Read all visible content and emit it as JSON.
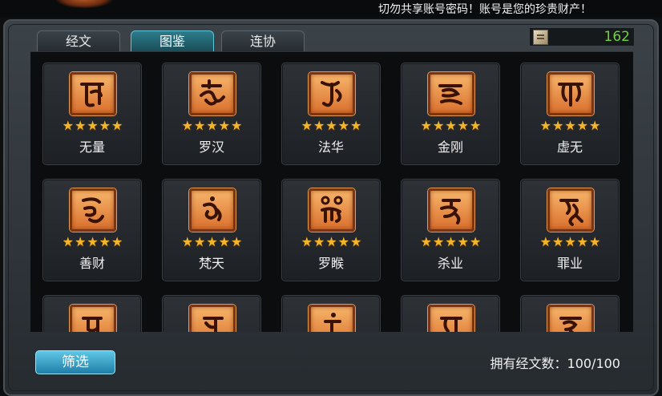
{
  "top_banner": {
    "message": "切勿共享账号密码！账号是您的珍贵财产！"
  },
  "tabs": [
    {
      "label": "经文",
      "active": false
    },
    {
      "label": "图鉴",
      "active": true
    },
    {
      "label": "连协",
      "active": false
    }
  ],
  "currency": {
    "icon": "scroll-icon",
    "value": "162",
    "color": "#6cd33a"
  },
  "star_glyphs": "★★★★★",
  "cards": [
    {
      "name": "无量",
      "stars": 5,
      "icon": "rune-wuliang-icon"
    },
    {
      "name": "罗汉",
      "stars": 5,
      "icon": "rune-luohan-icon"
    },
    {
      "name": "法华",
      "stars": 5,
      "icon": "rune-fahua-icon"
    },
    {
      "name": "金刚",
      "stars": 5,
      "icon": "rune-jingang-icon"
    },
    {
      "name": "虚无",
      "stars": 5,
      "icon": "rune-xuwu-icon"
    },
    {
      "name": "善财",
      "stars": 5,
      "icon": "rune-shancai-icon"
    },
    {
      "name": "梵天",
      "stars": 5,
      "icon": "rune-fantian-icon"
    },
    {
      "name": "罗睺",
      "stars": 5,
      "icon": "rune-luohou-icon"
    },
    {
      "name": "杀业",
      "stars": 5,
      "icon": "rune-shaye-icon"
    },
    {
      "name": "罪业",
      "stars": 5,
      "icon": "rune-zuiye-icon"
    },
    {
      "name": "",
      "stars": 0,
      "icon": "rune-icon"
    },
    {
      "name": "",
      "stars": 0,
      "icon": "rune-icon"
    },
    {
      "name": "",
      "stars": 0,
      "icon": "rune-icon"
    },
    {
      "name": "",
      "stars": 0,
      "icon": "rune-icon"
    },
    {
      "name": "",
      "stars": 0,
      "icon": "rune-icon"
    }
  ],
  "footer": {
    "filter_label": "筛选",
    "count_text": "拥有经文数：100/100"
  },
  "colors": {
    "accent": "#2d7d8c",
    "star": "#f4b52a",
    "icon_bg": "#e8883d"
  }
}
